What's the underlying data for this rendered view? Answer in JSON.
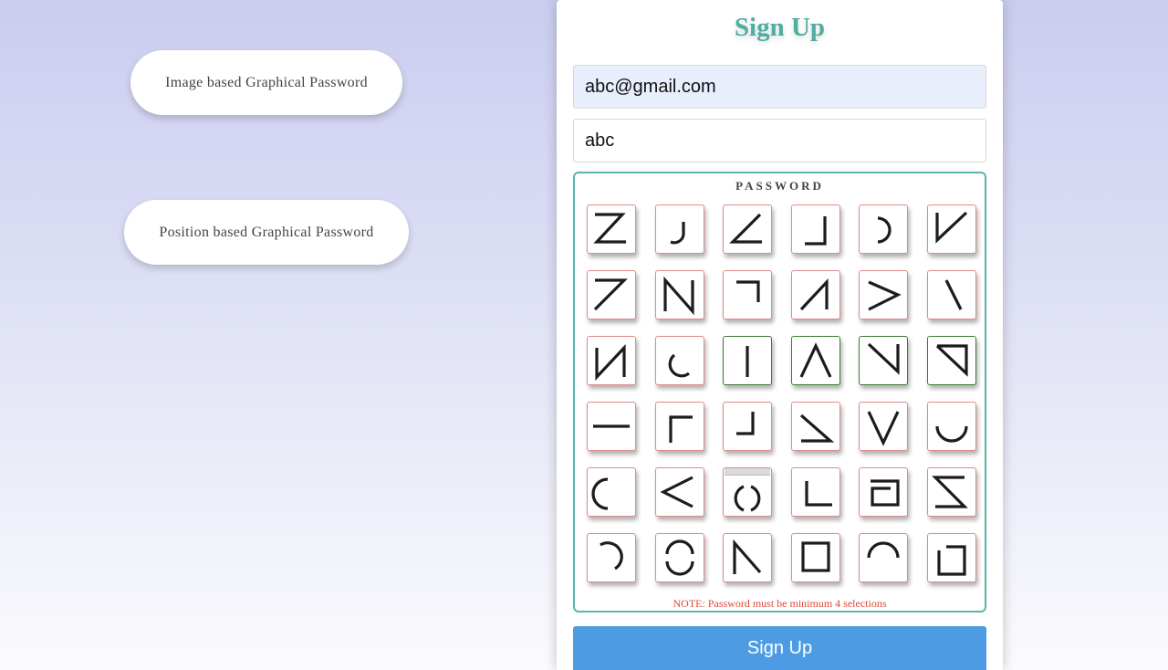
{
  "options": {
    "image_based_label": "Image based Graphical Password",
    "position_based_label": "Position based Graphical Password"
  },
  "form": {
    "title": "Sign Up",
    "email_value": "abc@gmail.com",
    "name_value": "abc",
    "password_label": "PASSWORD",
    "note": "NOTE: Password must be minimum 4 selections",
    "submit_label": "Sign Up"
  },
  "colors": {
    "title": "#4fada3",
    "submit": "#4d9be3",
    "note": "#e0483a",
    "tile_border": "#e08a8a",
    "selected_border": "#3d7a32"
  },
  "tiles": [
    {
      "icon": "z-stroke-icon",
      "selected": false
    },
    {
      "icon": "j-hook-icon",
      "selected": false
    },
    {
      "icon": "angle-icon",
      "selected": false
    },
    {
      "icon": "corner-bottom-right-icon",
      "selected": false
    },
    {
      "icon": "right-arc-icon",
      "selected": false
    },
    {
      "icon": "v-half-icon",
      "selected": false
    },
    {
      "icon": "seven-stroke-icon",
      "selected": false
    },
    {
      "icon": "n-stroke-icon",
      "selected": false
    },
    {
      "icon": "corner-top-right-icon",
      "selected": false
    },
    {
      "icon": "half-triangle-icon",
      "selected": false
    },
    {
      "icon": "greater-than-icon",
      "selected": false
    },
    {
      "icon": "backslash-icon",
      "selected": false
    },
    {
      "icon": "reverse-n-icon",
      "selected": false
    },
    {
      "icon": "left-arc-icon",
      "selected": false
    },
    {
      "icon": "vertical-line-icon",
      "selected": true
    },
    {
      "icon": "caret-up-icon",
      "selected": true
    },
    {
      "icon": "reverse-half-v-icon",
      "selected": true
    },
    {
      "icon": "reverse-seven-icon",
      "selected": true
    },
    {
      "icon": "horizontal-line-icon",
      "selected": false
    },
    {
      "icon": "corner-top-left-icon",
      "selected": false
    },
    {
      "icon": "corner-bottom-right-small-icon",
      "selected": false
    },
    {
      "icon": "half-triangle-down-icon",
      "selected": false
    },
    {
      "icon": "v-stroke-icon",
      "selected": false
    },
    {
      "icon": "u-arc-icon",
      "selected": false
    },
    {
      "icon": "c-arc-icon",
      "selected": false
    },
    {
      "icon": "less-than-icon",
      "selected": false
    },
    {
      "icon": "circle-split-icon",
      "selected": false
    },
    {
      "icon": "corner-bottom-left-icon",
      "selected": false
    },
    {
      "icon": "bracket-square-icon",
      "selected": false
    },
    {
      "icon": "sigma-stroke-icon",
      "selected": false
    },
    {
      "icon": "top-right-arc-icon",
      "selected": false
    },
    {
      "icon": "circle-gap-icon",
      "selected": false
    },
    {
      "icon": "n-half-icon",
      "selected": false
    },
    {
      "icon": "square-icon",
      "selected": false
    },
    {
      "icon": "arch-icon",
      "selected": false
    },
    {
      "icon": "square-open-icon",
      "selected": false
    }
  ]
}
